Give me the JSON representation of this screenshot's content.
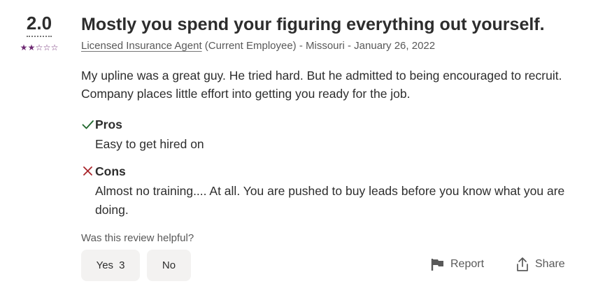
{
  "rating": {
    "value": "2.0",
    "stars_filled": 2,
    "stars_total": 5,
    "star_color": "#6e2a73"
  },
  "review": {
    "title": "Mostly you spend your figuring everything out yourself.",
    "job_title": "Licensed Insurance Agent",
    "meta_rest": " (Current Employee) - Missouri - January 26, 2022",
    "text": "My upline was a great guy. He tried hard. But he admitted to being encouraged to recruit. Company places little effort into getting you ready for the job.",
    "pros": {
      "label": "Pros",
      "text": "Easy to get hired on",
      "icon": "checkmark-icon",
      "color": "#1f662c"
    },
    "cons": {
      "label": "Cons",
      "text": "Almost no training.... At all. You are pushed to buy leads before you know what you are doing.",
      "icon": "x-icon",
      "color": "#a9252b"
    }
  },
  "feedback": {
    "question": "Was this review helpful?",
    "yes_label": "Yes",
    "yes_count": "3",
    "no_label": "No"
  },
  "actions": {
    "report_label": "Report",
    "report_icon": "flag-icon",
    "share_label": "Share",
    "share_icon": "share-icon"
  }
}
